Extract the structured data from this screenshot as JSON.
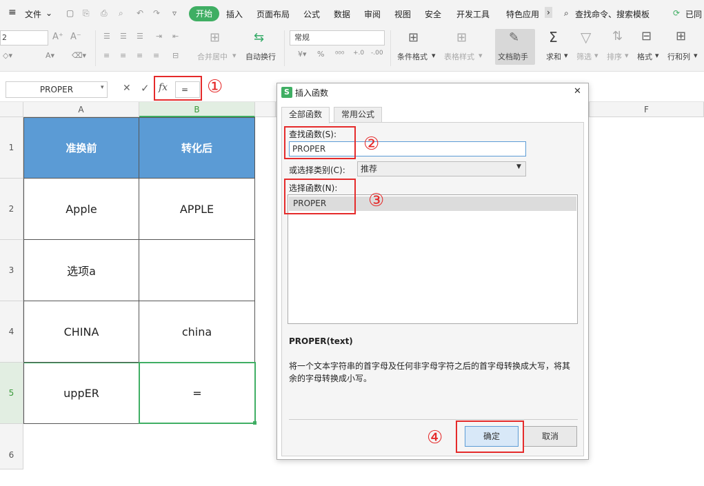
{
  "menubar": {
    "file_label": "文件",
    "tabs": [
      "开始",
      "插入",
      "页面布局",
      "公式",
      "数据",
      "审阅",
      "视图",
      "安全",
      "开发工具",
      "特色应用"
    ],
    "search_label": "查找命令、搜索模板",
    "sync_label": "已同"
  },
  "ribbon": {
    "font_size_value": "2",
    "merge_label": "合并居中",
    "wrap_label": "自动换行",
    "number_format": "常规",
    "conditional_label": "条件格式",
    "table_style_label": "表格样式",
    "doc_assist_label": "文档助手",
    "sum_label": "求和",
    "filter_label": "筛选",
    "sort_label": "排序",
    "format_label": "格式",
    "rowcol_label": "行和列"
  },
  "formula_bar": {
    "name_box": "PROPER",
    "cancel_symbol": "✕",
    "confirm_symbol": "✓",
    "fx_label": "fx",
    "content": "="
  },
  "annotations": [
    "①",
    "②",
    "③",
    "④"
  ],
  "sheet": {
    "columns": [
      "A",
      "B",
      "F"
    ],
    "rows": [
      "1",
      "2",
      "3",
      "4",
      "5",
      "6"
    ],
    "col_a": [
      "准换前",
      "Apple",
      "选项a",
      "CHINA",
      "uppER"
    ],
    "col_b": [
      "转化后",
      "APPLE",
      "",
      "china",
      "="
    ]
  },
  "dialog": {
    "title": "插入函数",
    "close": "✕",
    "tab_all": "全部函数",
    "tab_common": "常用公式",
    "search_label": "查找函数(S):",
    "search_value": "PROPER",
    "category_label": "或选择类别(C):",
    "category_value": "推荐",
    "select_label": "选择函数(N):",
    "function_item": "PROPER",
    "signature": "PROPER(text)",
    "description": "将一个文本字符串的首字母及任何非字母字符之后的首字母转换成大写，将其余的字母转换成小写。",
    "ok": "确定",
    "cancel": "取消"
  },
  "colors": {
    "accent_green": "#3fae63",
    "header_fill": "#5b9bd5",
    "annotation_red": "#e52a2a"
  }
}
